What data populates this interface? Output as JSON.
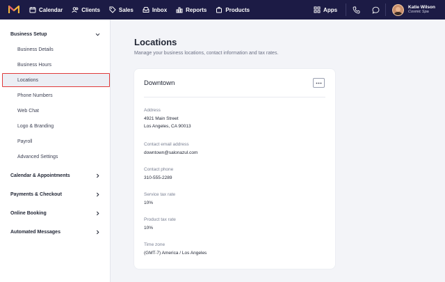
{
  "topnav": {
    "items": [
      {
        "label": "Calendar",
        "icon": "calendar-icon"
      },
      {
        "label": "Clients",
        "icon": "clients-icon"
      },
      {
        "label": "Sales",
        "icon": "tag-icon"
      },
      {
        "label": "Inbox",
        "icon": "inbox-icon"
      },
      {
        "label": "Reports",
        "icon": "bar-chart-icon"
      },
      {
        "label": "Products",
        "icon": "bag-icon"
      }
    ],
    "apps_label": "Apps",
    "user": {
      "name": "Katie Wilson",
      "business": "Cosmic Spa"
    },
    "colors": {
      "bar": "#1c1b45",
      "logo_primary": "#f3b63b",
      "logo_secondary": "#e35d6a"
    }
  },
  "sidebar": {
    "sections": [
      {
        "label": "Business Setup",
        "expanded": true,
        "items": [
          "Business Details",
          "Business Hours",
          "Locations",
          "Phone Numbers",
          "Web Chat",
          "Logo & Branding",
          "Payroll",
          "Advanced Settings"
        ]
      },
      {
        "label": "Calendar & Appointments",
        "expanded": false
      },
      {
        "label": "Payments & Checkout",
        "expanded": false
      },
      {
        "label": "Online Booking",
        "expanded": false
      },
      {
        "label": "Automated Messages",
        "expanded": false
      }
    ],
    "active_item": "Locations",
    "highlight_color": "#e03a3a"
  },
  "main": {
    "title": "Locations",
    "description": "Manage your business locations, contact information and tax rates.",
    "location_card": {
      "name": "Downtown",
      "fields": {
        "address_label": "Address",
        "address_line1": "4921 Main Street",
        "address_line2": "Los Angeles, CA 90013",
        "email_label": "Contact email address",
        "email_value": "downtown@salonazul.com",
        "phone_label": "Contact phone",
        "phone_value": "310-555-2289",
        "service_tax_label": "Service tax rate",
        "service_tax_value": "10%",
        "product_tax_label": "Product tax rate",
        "product_tax_value": "10%",
        "timezone_label": "Time zone",
        "timezone_value": "(GMT-7) America / Los Angeles"
      }
    }
  }
}
